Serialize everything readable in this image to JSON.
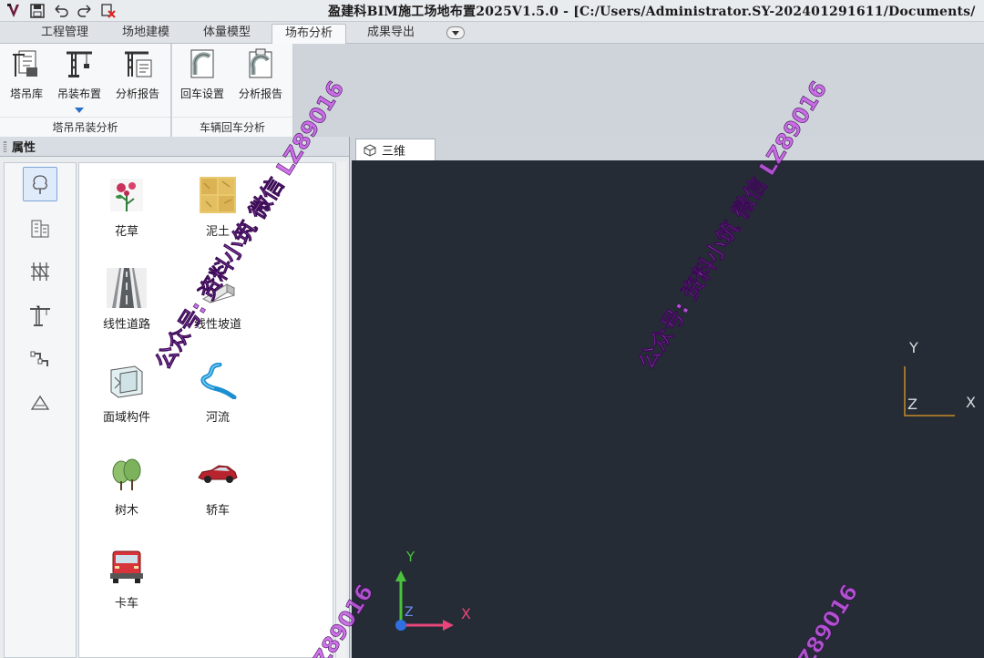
{
  "app": {
    "title": "盈建科BIM施工场地布置2025V1.5.0 - [C:/Users/Administrator.SY-202401291611/Documents/"
  },
  "tabs": [
    {
      "label": "工程管理",
      "active": false
    },
    {
      "label": "场地建模",
      "active": false
    },
    {
      "label": "体量模型",
      "active": false
    },
    {
      "label": "场布分析",
      "active": true
    },
    {
      "label": "成果导出",
      "active": false
    }
  ],
  "ribbon": {
    "group1": {
      "label": "塔吊吊装分析",
      "buttons": [
        "塔吊库",
        "吊装布置",
        "分析报告"
      ]
    },
    "group2": {
      "label": "车辆回车分析",
      "buttons": [
        "回车设置",
        "分析报告"
      ]
    }
  },
  "properties": {
    "title": "属性",
    "categories": [
      {
        "icon": "tree-category-icon",
        "selected": true
      },
      {
        "icon": "building-category-icon",
        "selected": false
      },
      {
        "icon": "scaffold-category-icon",
        "selected": false
      },
      {
        "icon": "tower-crane-category-icon",
        "selected": false
      },
      {
        "icon": "pipe-category-icon",
        "selected": false
      },
      {
        "icon": "terrain-category-icon",
        "selected": false
      }
    ],
    "items": [
      {
        "label": "花草",
        "icon": "flower-icon"
      },
      {
        "label": "泥土",
        "icon": "soil-icon"
      },
      {
        "label": "线性道路",
        "icon": "road-icon"
      },
      {
        "label": "线性坡道",
        "icon": "ramp-icon"
      },
      {
        "label": "面域构件",
        "icon": "area-component-icon"
      },
      {
        "label": "河流",
        "icon": "river-icon"
      },
      {
        "label": "树木",
        "icon": "trees-icon"
      },
      {
        "label": "轿车",
        "icon": "car-icon"
      },
      {
        "label": "卡车",
        "icon": "truck-icon"
      }
    ]
  },
  "viewport": {
    "tab_label": "三维",
    "axes": {
      "x": "X",
      "y": "Y",
      "z": "Z"
    }
  },
  "watermark": {
    "text": "公众号: 资料小筑 微信 LZ89016",
    "partial": "Z89016"
  },
  "colors": {
    "viewport_bg": "#252c35",
    "axis_x": "#e8467a",
    "axis_y": "#4ac23c",
    "axis_z": "#2f6fe0",
    "watermark": "#c85ae6"
  }
}
